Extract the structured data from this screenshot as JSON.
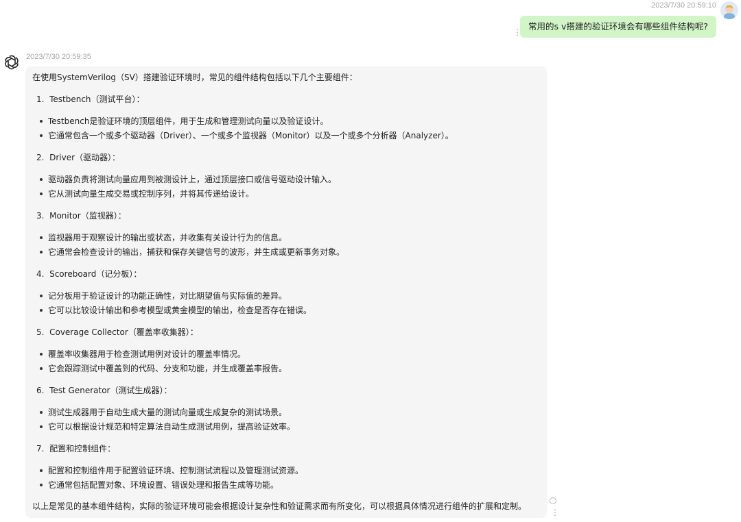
{
  "user": {
    "timestamp": "2023/7/30 20:59:10",
    "message": "常用的s v搭建的验证环境会有哪些组件结构呢?"
  },
  "assistant": {
    "timestamp": "2023/7/30 20:59:35",
    "intro": "在使用SystemVerilog（SV）搭建验证环境时，常见的组件结构包括以下几个主要组件：",
    "sections": [
      {
        "number": "1.",
        "title": "Testbench（测试平台）：",
        "bullets": [
          "Testbench是验证环境的顶层组件，用于生成和管理测试向量以及验证设计。",
          "它通常包含一个或多个驱动器（Driver）、一个或多个监视器（Monitor）以及一个或多个分析器（Analyzer）。"
        ]
      },
      {
        "number": "2.",
        "title": "Driver（驱动器）：",
        "bullets": [
          "驱动器负责将测试向量应用到被测设计上，通过顶层接口或信号驱动设计输入。",
          "它从测试向量生成交易或控制序列，并将其传递给设计。"
        ]
      },
      {
        "number": "3.",
        "title": "Monitor（监视器）：",
        "bullets": [
          "监视器用于观察设计的输出或状态，并收集有关设计行为的信息。",
          "它通常会检查设计的输出，捕获和保存关键信号的波形，并生成或更新事务对象。"
        ]
      },
      {
        "number": "4.",
        "title": "Scoreboard（记分板）：",
        "bullets": [
          "记分板用于验证设计的功能正确性，对比期望值与实际值的差异。",
          "它可以比较设计输出和参考模型或黄金模型的输出，检查是否存在错误。"
        ]
      },
      {
        "number": "5.",
        "title": "Coverage Collector（覆盖率收集器）：",
        "bullets": [
          "覆盖率收集器用于检查测试用例对设计的覆盖率情况。",
          "它会跟踪测试中覆盖到的代码、分支和功能，并生成覆盖率报告。"
        ]
      },
      {
        "number": "6.",
        "title": "Test Generator（测试生成器）：",
        "bullets": [
          "测试生成器用于自动生成大量的测试向量或生成复杂的测试场景。",
          "它可以根据设计规范和特定算法自动生成测试用例，提高验证效率。"
        ]
      },
      {
        "number": "7.",
        "title": "配置和控制组件：",
        "bullets": [
          "配置和控制组件用于配置验证环境、控制测试流程以及管理测试资源。",
          "它通常包括配置对象、环境设置、错误处理和报告生成等功能。"
        ]
      }
    ],
    "conclusion": "以上是常见的基本组件结构，实际的验证环境可能会根据设计复杂性和验证需求而有所变化，可以根据具体情况进行组件的扩展和定制。"
  },
  "icons": {
    "user_avatar": "user-avatar-icon",
    "assistant_avatar": "openai-logo-icon",
    "more": "more-vertical-icon",
    "status": "circle-icon"
  },
  "colors": {
    "user_bubble": "#d2f5c8",
    "assistant_bubble": "#f5f5f5",
    "timestamp": "#a6a6a6"
  }
}
